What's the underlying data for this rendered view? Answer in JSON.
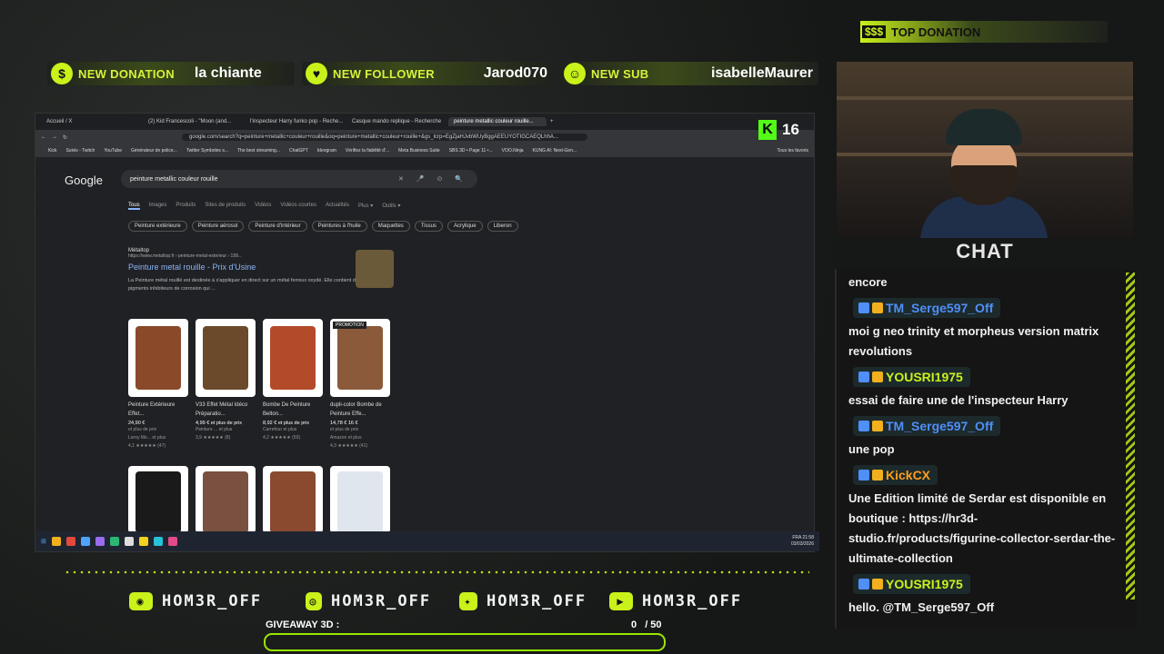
{
  "alerts": {
    "donation": {
      "label": "NEW DONATION",
      "value": "la chiante"
    },
    "follower": {
      "label": "NEW FOLLOWER",
      "value": "Jarod070"
    },
    "sub": {
      "label": "NEW SUB",
      "value": "isabelleMaurer"
    },
    "top_donation": {
      "label": "TOP DONATION",
      "icon_text": "$$$"
    }
  },
  "viewers": {
    "count": "16",
    "platform_icon": "K"
  },
  "browser": {
    "tabs": [
      "Accueil / X",
      "(2) Kid Francescoli - \"Moon (and...",
      "l'inspecteur Harry funko pop - Reche...",
      "Casque mando replique - Recherche",
      "peinture metallic couleur rouille..."
    ],
    "url": "google.com/search?q=peinture+metallic+couleur+rouille&oq=peinture+metallic+couleur+rouille+&gs_lcrp=EgZjaHJvbWUyBggAEEUYOTIGCAEQLhhA...",
    "bookmarks": [
      "Kick",
      "Suivis - Twitch",
      "YouTube",
      "Générateur de police...",
      "Twitter Symboles s...",
      "The best streaming...",
      "ChatGPT",
      "Ideogram",
      "Vérifiez la fiabilité d'...",
      "Meta Business Suite",
      "SBS 3D • Page 11 •...",
      "VOO.Ninja",
      "KUNG AI: Next-Gen...",
      "Tous les favoris"
    ]
  },
  "google": {
    "logo": "Google",
    "query": "peinture metallic couleur rouille",
    "nav": [
      "Tous",
      "Images",
      "Produits",
      "Sites de produits",
      "Vidéos",
      "Vidéos courtes",
      "Actualités",
      "Plus ▾",
      "Outils ▾"
    ],
    "chips": [
      "Peinture extérieure",
      "Peinture aérosol",
      "Peinture d'intérieur",
      "Peintures à l'huile",
      "Maquettes",
      "Tissus",
      "Acrylique",
      "Liberon"
    ],
    "result": {
      "site": "Métaltop",
      "url": "https://www.metaltop.fr › peinture-metal-exterieur › 199...",
      "title": "Peinture metal rouille - Prix d'Usine",
      "desc": "La Peinture métal rouillé est destinée à s'appliquer en direct sur un métal ferreux oxydé. Elle contient différents pigments inhibiteurs de corrosion qui ..."
    },
    "products": [
      {
        "name": "Peinture Extérieure Effet...",
        "price": "24,90 €",
        "extra": "et plus de prix",
        "seller": "Leroy Me... et plus",
        "rating": "4,1 ★★★★★ (47)",
        "color": "#8a4a2a"
      },
      {
        "name": "V33 Effet Métal Idéco Préparatio...",
        "price": "4,99 € et plus de prix",
        "extra": "",
        "seller": "Peinture ... et plus",
        "rating": "3,9 ★★★★★ (8)",
        "color": "#6a4a2a"
      },
      {
        "name": "Bombe De Peinture Belton...",
        "price": "8,92 € et plus de prix",
        "extra": "",
        "seller": "Carrefour et plus",
        "rating": "4,2 ★★★★★ (50)",
        "color": "#b34a2a"
      },
      {
        "name": "dupli-color Bombe de Peinture Effe...",
        "price": "14,78 € 16 €",
        "extra": "et plus de prix",
        "seller": "Amazon et plus",
        "rating": "4,3 ★★★★★ (41)",
        "color": "#8a5a3a",
        "badge": "PROMOTION"
      }
    ],
    "products_row2_colors": [
      "#1a1a1a",
      "#7a5040",
      "#8a4a30",
      "#e0e6ee"
    ]
  },
  "taskbar": {
    "lang": "FRA",
    "time": "21:58",
    "date": "03/03/2026"
  },
  "chat": {
    "title": "CHAT",
    "messages": [
      {
        "user": "",
        "text": "encore"
      },
      {
        "user": "TM_Serge597_Off",
        "color": "#4f8ff7",
        "text": "moi g neo trinity et morpheus version matrix revolutions"
      },
      {
        "user": "YOUSRI1975",
        "color": "#c9f21a",
        "text": "essai de faire une de l'inspecteur Harry"
      },
      {
        "user": "TM_Serge597_Off",
        "color": "#4f8ff7",
        "text": "une pop"
      },
      {
        "user": "KickCX",
        "color": "#ff9f1a",
        "text": "Une Edition limité de Serdar est disponible en boutique : https://hr3d-studio.fr/products/figurine-collector-serdar-the-ultimate-collection"
      },
      {
        "user": "YOUSRI1975",
        "color": "#c9f21a",
        "text": "hello. @TM_Serge597_Off"
      }
    ]
  },
  "socials": [
    {
      "icon": "discord-icon",
      "handle": "HOM3R_OFF",
      "color": "#c9f21a"
    },
    {
      "icon": "instagram-icon",
      "handle": "HOM3R_OFF",
      "color": "#c9f21a"
    },
    {
      "icon": "twitter-icon",
      "handle": "HOM3R_OFF",
      "color": "#c9f21a"
    },
    {
      "icon": "youtube-icon",
      "handle": "HOM3R_OFF",
      "color": "#c9f21a"
    }
  ],
  "giveaway": {
    "label": "GIVEAWAY 3D :",
    "count": "0",
    "total": "/ 50",
    "progress": 0
  },
  "colors": {
    "accent": "#c9f21a",
    "bar": "#9ae600"
  }
}
